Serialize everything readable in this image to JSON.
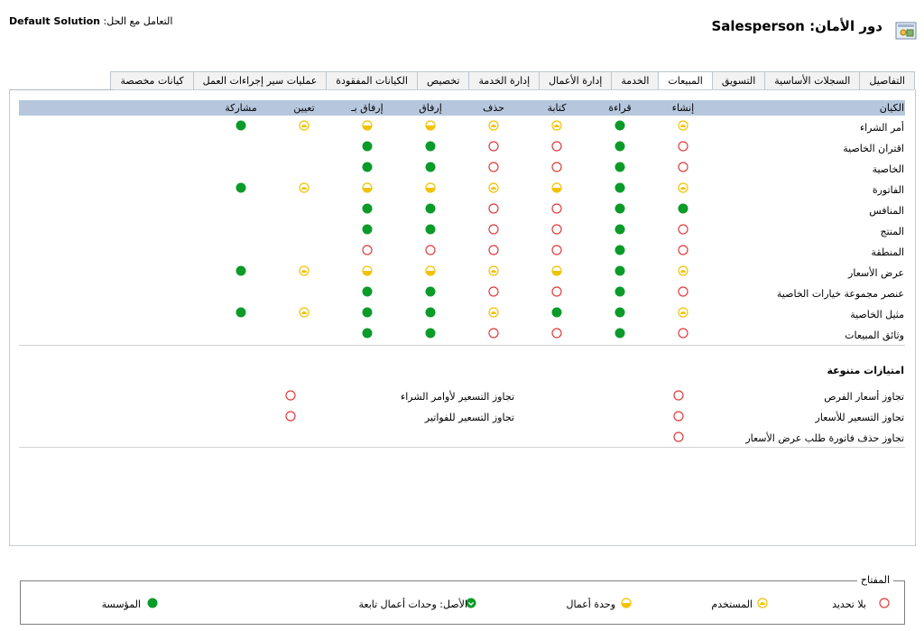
{
  "header": {
    "title": "دور الأمان: Salesperson",
    "solution_label": "التعامل مع الحل:",
    "solution_name": "Default Solution"
  },
  "tabs": [
    {
      "label": "التفاصيل",
      "active": false
    },
    {
      "label": "السجلات الأساسية",
      "active": false
    },
    {
      "label": "التسويق",
      "active": false
    },
    {
      "label": "المبيعات",
      "active": true
    },
    {
      "label": "الخدمة",
      "active": false
    },
    {
      "label": "إدارة الأعمال",
      "active": false
    },
    {
      "label": "إدارة الخدمة",
      "active": false
    },
    {
      "label": "تخصيص",
      "active": false
    },
    {
      "label": "الكيانات المفقودة",
      "active": false
    },
    {
      "label": "عمليات سير إجراءات العمل",
      "active": false
    },
    {
      "label": "كيانات مخصصة",
      "active": false
    }
  ],
  "table": {
    "entity_header": "الكيان",
    "columns": [
      "إنشاء",
      "قراءة",
      "كتابة",
      "حذف",
      "إرفاق",
      "إرفاق بـ",
      "تعيين",
      "مشاركة"
    ],
    "rows": [
      {
        "name": "أمر الشراء",
        "levels": [
          "user",
          "org",
          "user",
          "user",
          "bu",
          "bu",
          "user",
          "org"
        ]
      },
      {
        "name": "اقتران الخاصية",
        "levels": [
          "none",
          "org",
          "none",
          "none",
          "org",
          "org",
          "",
          ""
        ]
      },
      {
        "name": "الخاصية",
        "levels": [
          "none",
          "org",
          "none",
          "none",
          "org",
          "org",
          "",
          ""
        ]
      },
      {
        "name": "الفاتورة",
        "levels": [
          "user",
          "org",
          "bu",
          "user",
          "bu",
          "bu",
          "user",
          "org"
        ]
      },
      {
        "name": "المنافس",
        "levels": [
          "org",
          "org",
          "none",
          "none",
          "org",
          "org",
          "",
          ""
        ]
      },
      {
        "name": "المنتج",
        "levels": [
          "none",
          "org",
          "none",
          "none",
          "org",
          "org",
          "",
          ""
        ]
      },
      {
        "name": "المنطقة",
        "levels": [
          "none",
          "org",
          "none",
          "none",
          "none",
          "none",
          "",
          ""
        ]
      },
      {
        "name": "عرض الأسعار",
        "levels": [
          "user",
          "org",
          "bu",
          "user",
          "bu",
          "bu",
          "user",
          "org"
        ]
      },
      {
        "name": "عنصر مجموعة خيارات الخاصية",
        "levels": [
          "none",
          "org",
          "none",
          "none",
          "org",
          "org",
          "",
          ""
        ]
      },
      {
        "name": "مثيل الخاصية",
        "levels": [
          "user",
          "org",
          "org",
          "user",
          "org",
          "org",
          "user",
          "org"
        ]
      },
      {
        "name": "وثائق المبيعات",
        "levels": [
          "none",
          "org",
          "none",
          "none",
          "org",
          "org",
          "",
          ""
        ]
      }
    ]
  },
  "misc": {
    "title": "امتيازات متنوعة",
    "items": [
      {
        "label": "تجاوز أسعار الفرص",
        "level": "none"
      },
      {
        "label": "تجاوز التسعير لأوامر الشراء",
        "level": "none"
      },
      {
        "label": "تجاوز التسعير للأسعار",
        "level": "none"
      },
      {
        "label": "تجاوز التسعير للفواتير",
        "level": "none"
      },
      {
        "label": "تجاوز حذف فاتورة طلب عرض الأسعار",
        "level": "none"
      }
    ]
  },
  "legend": {
    "title": "المفتاح",
    "items": [
      {
        "label": "بلا تحديد",
        "level": "none"
      },
      {
        "label": "المستخدم",
        "level": "user"
      },
      {
        "label": "وحدة أعمال",
        "level": "bu"
      },
      {
        "label": "الأصل: وحدات أعمال تابعة",
        "level": "parent"
      },
      {
        "label": "المؤسسة",
        "level": "org"
      }
    ]
  },
  "colors": {
    "header_band": "#b6c7dd",
    "org_green": "#0a9b28",
    "level_yellow": "#f2c200",
    "none_red": "#e03c3c"
  }
}
